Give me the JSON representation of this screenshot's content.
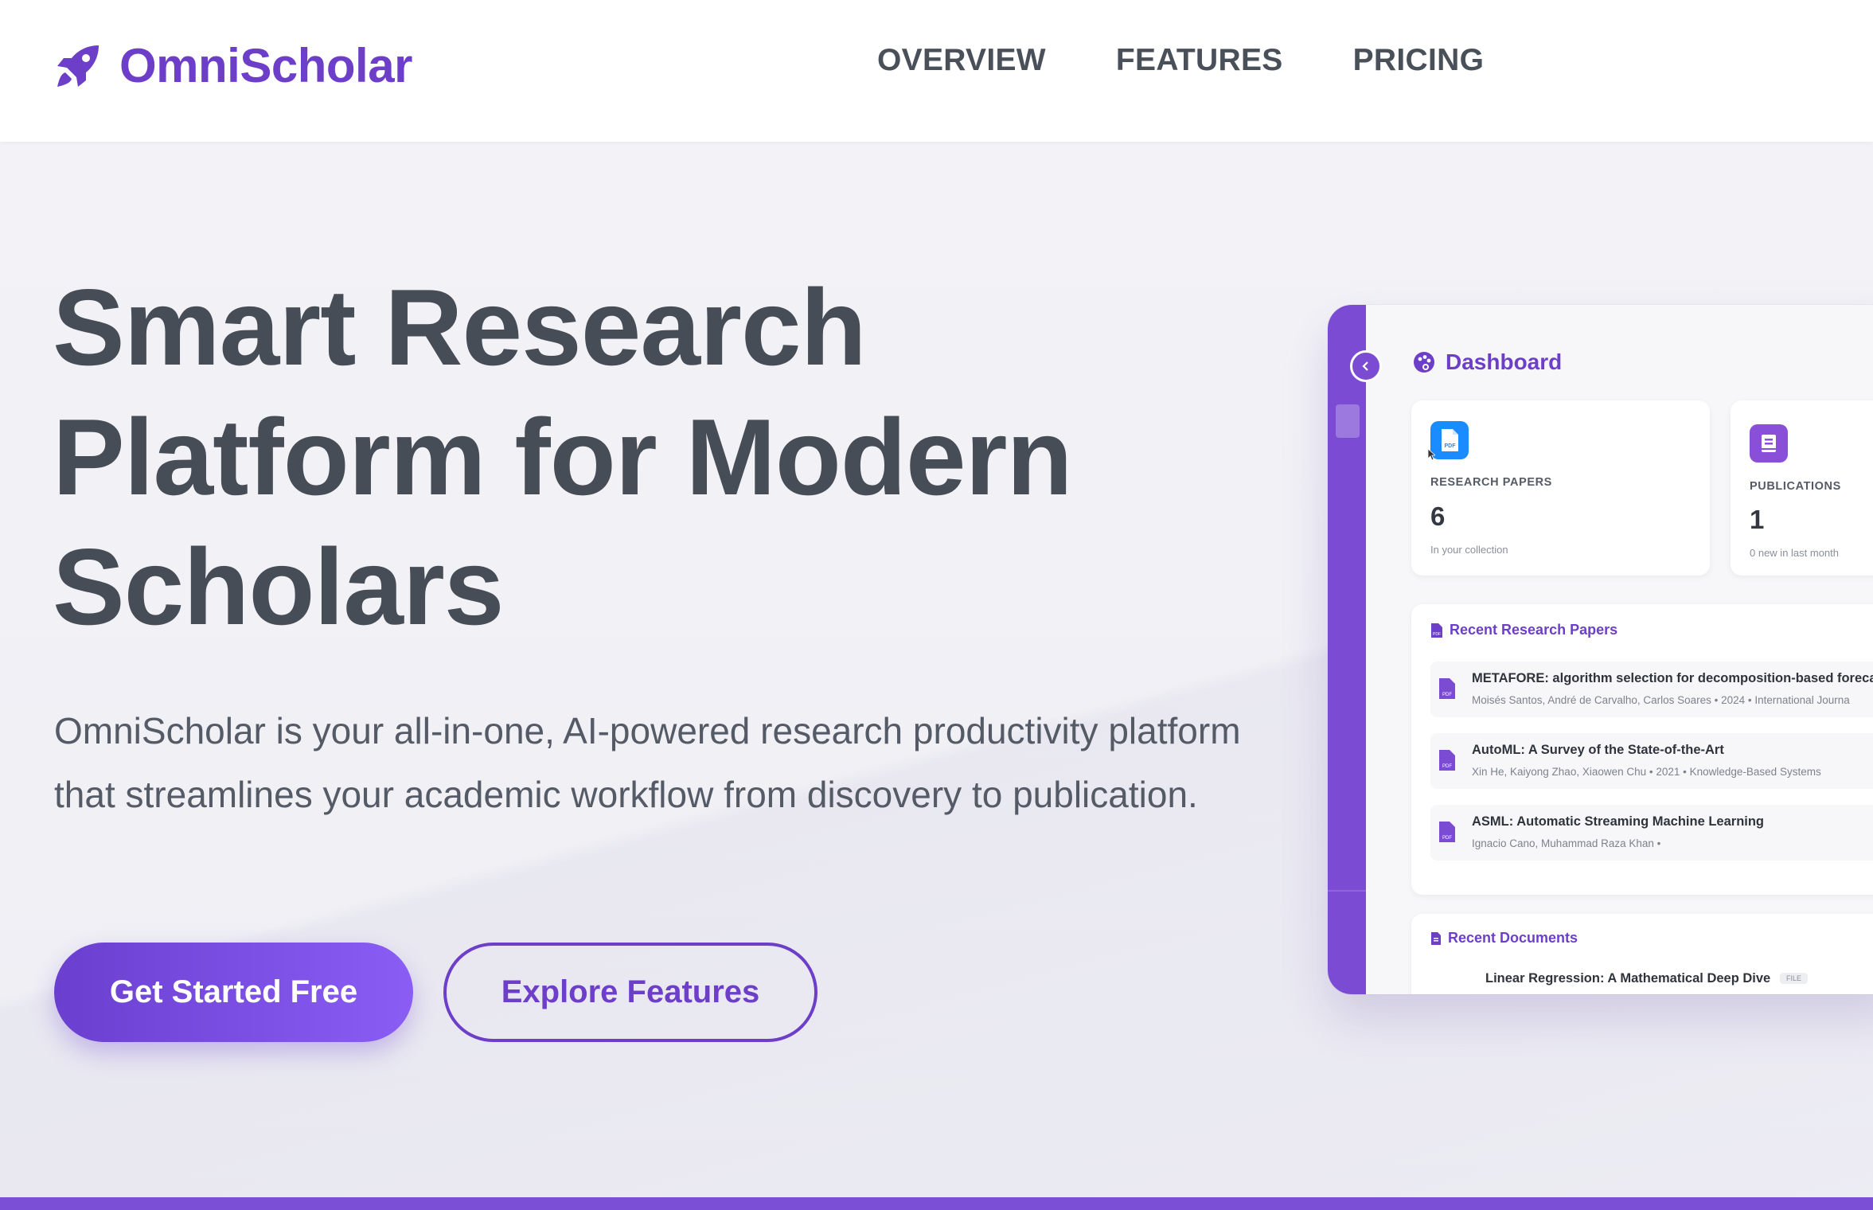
{
  "brand": {
    "name": "OmniScholar",
    "accent": "#6d3fc9",
    "icon": "rocket-icon"
  },
  "nav": {
    "items": [
      "OVERVIEW",
      "FEATURES",
      "PRICING"
    ]
  },
  "hero": {
    "title": "Smart Research Platform for Modern Scholars",
    "subtitle": "OmniScholar is your all-in-one, AI-powered research productivity platform that streamlines your academic workflow from discovery to publication.",
    "primary_cta": "Get Started Free",
    "secondary_cta": "Explore Features"
  },
  "dashboard": {
    "title": "Dashboard",
    "stats": [
      {
        "label": "RESEARCH PAPERS",
        "value": "6",
        "note": "In your collection",
        "icon": "pdf-icon",
        "color": "#1a8cff"
      },
      {
        "label": "PUBLICATIONS",
        "value": "1",
        "note": "0 new in last month",
        "icon": "book-icon",
        "color": "#8a4fd8"
      }
    ],
    "recent_papers": {
      "heading": "Recent Research Papers",
      "items": [
        {
          "title": "METAFORE: algorithm selection for decomposition-based forecas",
          "meta": "Moisés Santos, André de Carvalho, Carlos Soares • 2024 • International Journa"
        },
        {
          "title": "AutoML: A Survey of the State-of-the-Art",
          "meta": "Xin He, Kaiyong Zhao, Xiaowen Chu • 2021 • Knowledge-Based Systems"
        },
        {
          "title": "ASML: Automatic Streaming Machine Learning",
          "meta": "Ignacio Cano, Muhammad Raza Khan •"
        }
      ]
    },
    "recent_documents": {
      "heading": "Recent Documents",
      "items": [
        {
          "title": "Linear Regression: A Mathematical Deep Dive",
          "badge": "FILE"
        }
      ]
    }
  }
}
